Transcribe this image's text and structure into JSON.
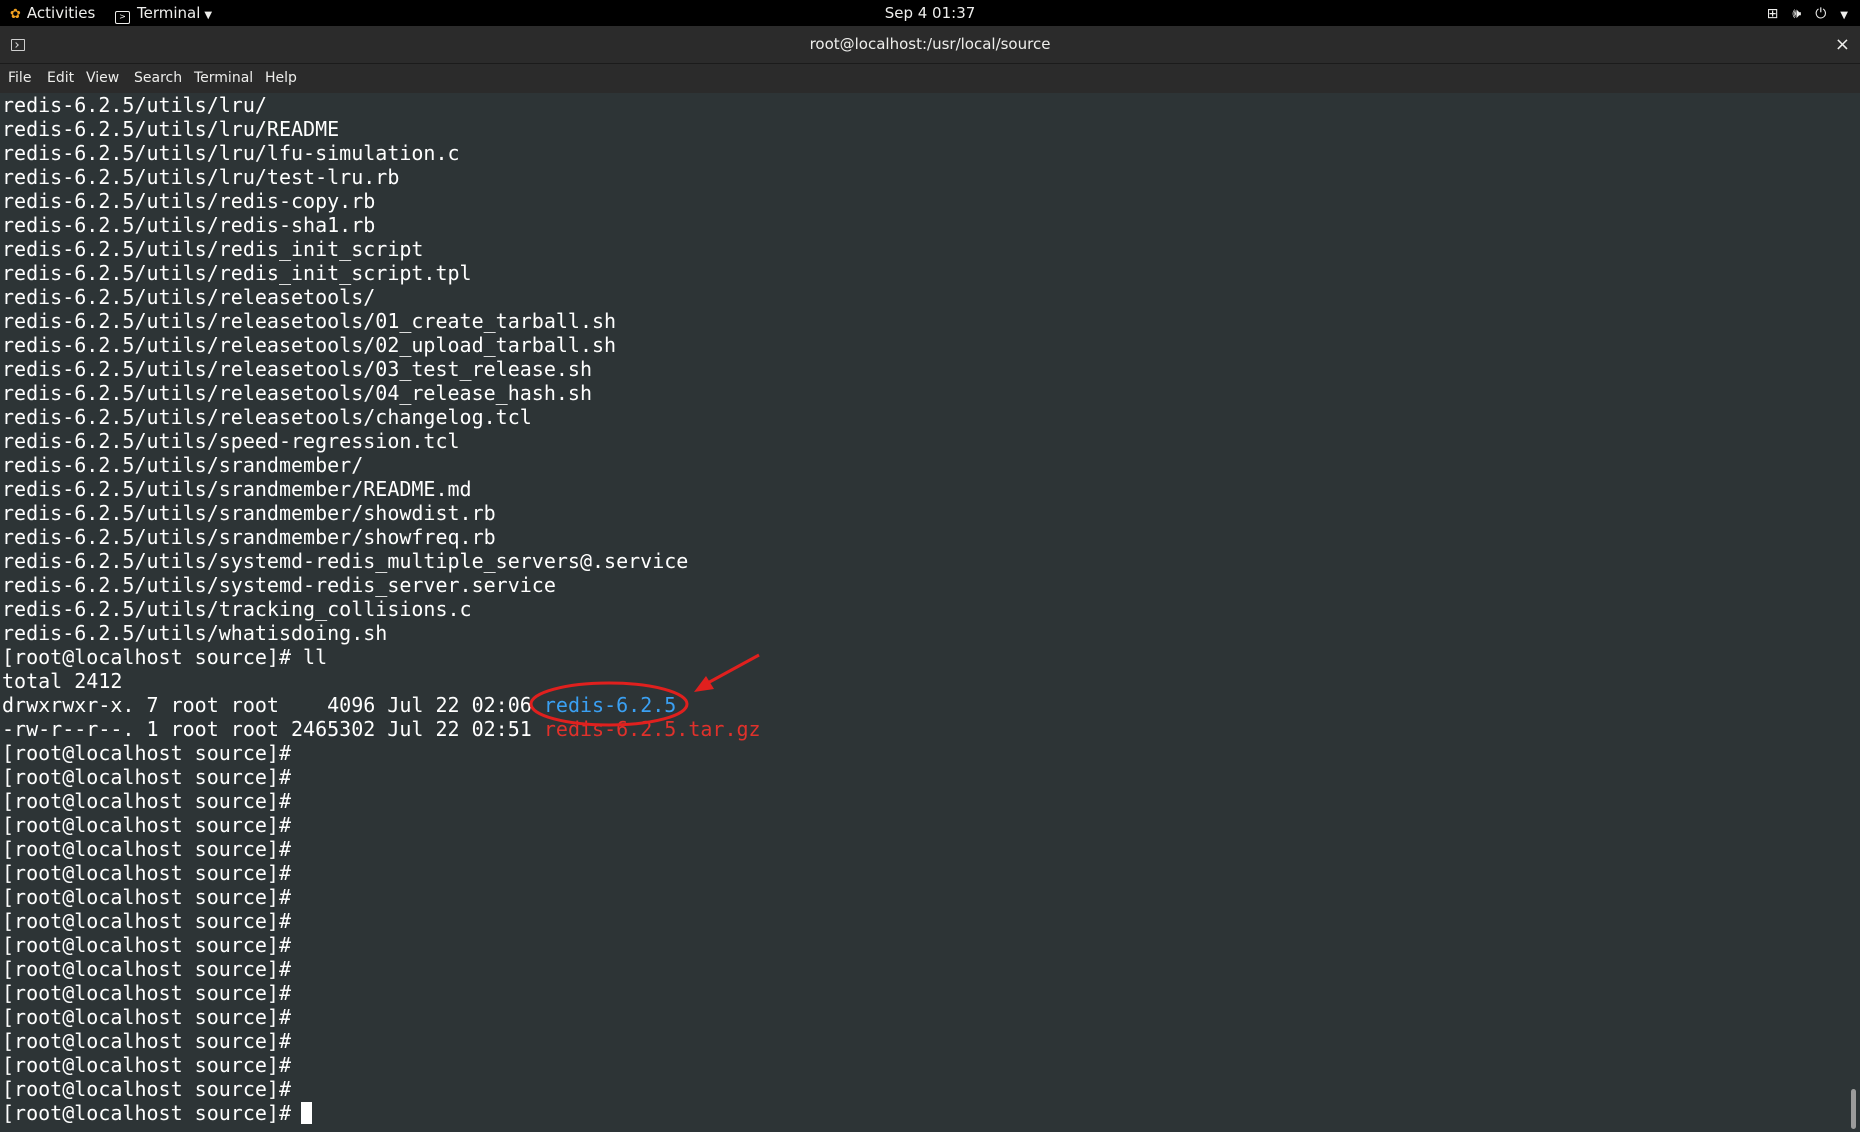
{
  "topbar": {
    "activities": "Activities",
    "app_name": "Terminal",
    "clock": "Sep 4  01:37",
    "tray_icons": [
      "network-icon",
      "volume-icon",
      "power-icon",
      "chevron-down-icon"
    ]
  },
  "window": {
    "title": "root@localhost:/usr/local/source",
    "close_glyph": "×"
  },
  "menu": {
    "items": [
      "File",
      "Edit",
      "View",
      "Search",
      "Terminal",
      "Help"
    ]
  },
  "terminal": {
    "lines": [
      "redis-6.2.5/utils/lru/",
      "redis-6.2.5/utils/lru/README",
      "redis-6.2.5/utils/lru/lfu-simulation.c",
      "redis-6.2.5/utils/lru/test-lru.rb",
      "redis-6.2.5/utils/redis-copy.rb",
      "redis-6.2.5/utils/redis-sha1.rb",
      "redis-6.2.5/utils/redis_init_script",
      "redis-6.2.5/utils/redis_init_script.tpl",
      "redis-6.2.5/utils/releasetools/",
      "redis-6.2.5/utils/releasetools/01_create_tarball.sh",
      "redis-6.2.5/utils/releasetools/02_upload_tarball.sh",
      "redis-6.2.5/utils/releasetools/03_test_release.sh",
      "redis-6.2.5/utils/releasetools/04_release_hash.sh",
      "redis-6.2.5/utils/releasetools/changelog.tcl",
      "redis-6.2.5/utils/speed-regression.tcl",
      "redis-6.2.5/utils/srandmember/",
      "redis-6.2.5/utils/srandmember/README.md",
      "redis-6.2.5/utils/srandmember/showdist.rb",
      "redis-6.2.5/utils/srandmember/showfreq.rb",
      "redis-6.2.5/utils/systemd-redis_multiple_servers@.service",
      "redis-6.2.5/utils/systemd-redis_server.service",
      "redis-6.2.5/utils/tracking_collisions.c",
      "redis-6.2.5/utils/whatisdoing.sh",
      "[root@localhost source]# ll",
      "total 2412"
    ],
    "listing": [
      {
        "prefix": "drwxrwxr-x. 7 root root    4096 Jul 22 02:06 ",
        "name": "redis-6.2.5",
        "kind": "dir"
      },
      {
        "prefix": "-rw-r--r--. 1 root root 2465302 Jul 22 02:51 ",
        "name": "redis-6.2.5.tar.gz",
        "kind": "archive"
      }
    ],
    "prompt": "[root@localhost source]#",
    "empty_prompt_count": 15,
    "colors": {
      "fg": "#ffffff",
      "bg": "#2d3436",
      "dir": "#3aa0f3",
      "archive": "#e0312b"
    }
  },
  "annotation": {
    "color": "#e0201e",
    "shape": "ellipse-with-arrow",
    "target": "redis-6.2.5"
  }
}
